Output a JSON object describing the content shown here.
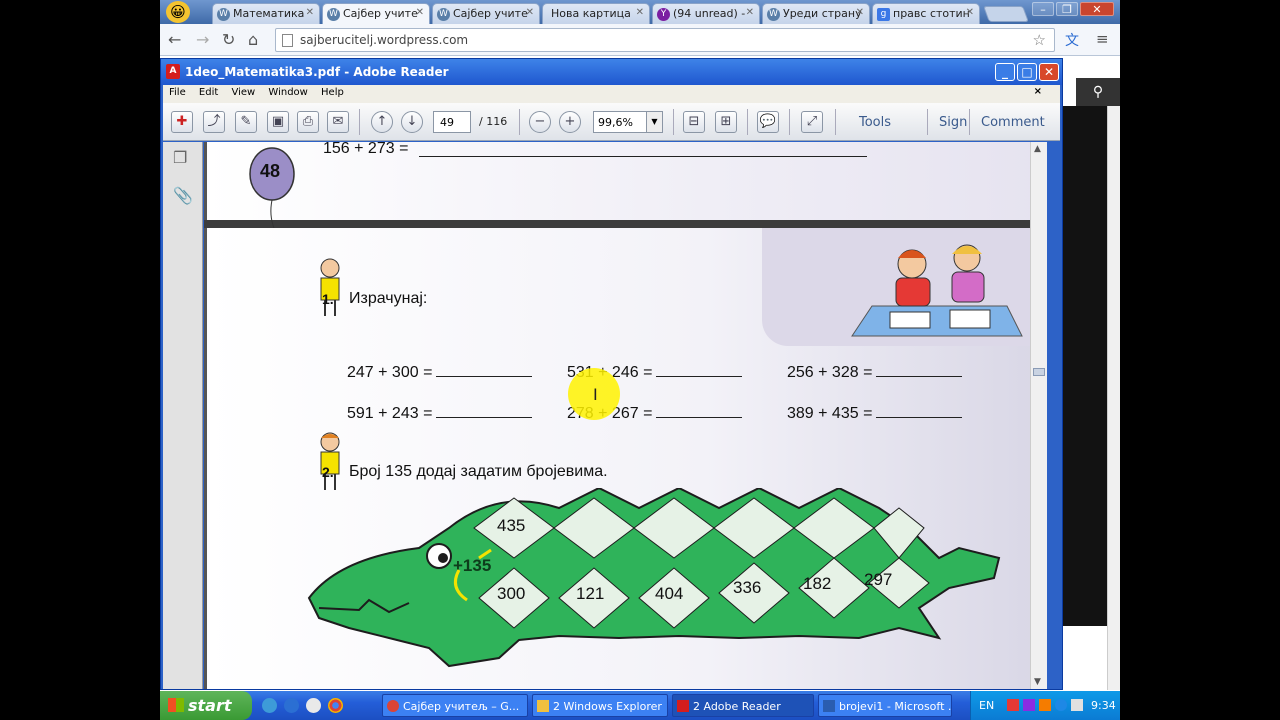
{
  "browser": {
    "tabs": [
      {
        "label": "Математика",
        "icon": "wordpress-icon",
        "active": false
      },
      {
        "label": "Сајбер учите",
        "icon": "wordpress-icon",
        "active": true
      },
      {
        "label": "Сајбер учите",
        "icon": "wordpress-icon",
        "active": false
      },
      {
        "label": "Нова картица",
        "icon": "blank-page-icon",
        "active": false
      },
      {
        "label": "(94 unread) -",
        "icon": "yahoo-mail-icon",
        "active": false
      },
      {
        "label": "Уреди страну",
        "icon": "wordpress-icon",
        "active": false
      },
      {
        "label": "правс стотин",
        "icon": "google-icon",
        "active": false
      }
    ],
    "address": "sajberucitelj.wordpress.com"
  },
  "reader": {
    "title": "1deo_Matematika3.pdf - Adobe Reader",
    "menu": [
      "File",
      "Edit",
      "View",
      "Window",
      "Help"
    ],
    "menu_close": "×",
    "page_current": "49",
    "page_total": "/ 116",
    "zoom": "99,6%",
    "tools_label": "Tools",
    "sign_label": "Sign",
    "comment_label": "Comment"
  },
  "document": {
    "prev_page_number": "48",
    "prev_page_equation": "156 + 273 =",
    "task1_number": "1.",
    "task1_title": "Израчунај:",
    "equations": [
      [
        "247 + 300 =",
        "531 + 246 =",
        "256 + 328 ="
      ],
      [
        "591 + 243 =",
        "278 + 267 =",
        "389 + 435 ="
      ]
    ],
    "task2_number": "2.",
    "task2_title": "Број 135 додај задатим бројевима.",
    "crocodile_operator": "+135",
    "crocodile_top": [
      "435"
    ],
    "crocodile_numbers": [
      "300",
      "121",
      "404",
      "336",
      "182",
      "297"
    ]
  },
  "taskbar": {
    "start_label": "start",
    "buttons": [
      {
        "label": "Сајбер учитељ – G...",
        "active": false
      },
      {
        "label": "2 Windows Explorer",
        "active": false
      },
      {
        "label": "2 Adobe Reader",
        "active": true
      },
      {
        "label": "brojevi1 - Microsoft ...",
        "active": false
      }
    ],
    "language": "EN",
    "time": "9:34"
  },
  "colors": {
    "reader_title": "#245edb",
    "croc_green": "#2fb35a",
    "note_yellow": "#f5e200"
  }
}
